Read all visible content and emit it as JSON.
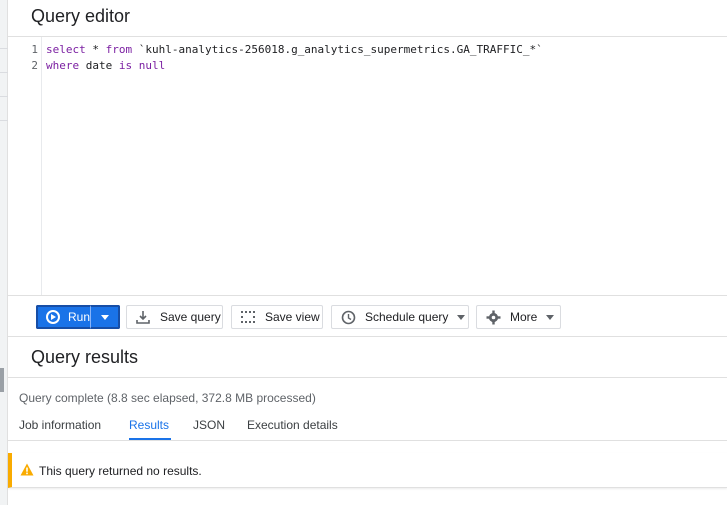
{
  "editor": {
    "title": "Query editor",
    "lines": [
      {
        "number": "1",
        "keyword1": "select",
        "middle": " * ",
        "keyword2": "from",
        "rest": " `kuhl-analytics-256018.g_analytics_supermetrics.GA_TRAFFIC_*`"
      },
      {
        "number": "2",
        "keyword1": "where",
        "middle": " date ",
        "keyword2": "is null",
        "rest": ""
      }
    ]
  },
  "toolbar": {
    "run_label": "Run",
    "save_query_label": "Save query",
    "save_view_label": "Save view",
    "schedule_query_label": "Schedule query",
    "more_label": "More"
  },
  "results": {
    "title": "Query results",
    "status": "Query complete (8.8 sec elapsed, 372.8 MB processed)",
    "tabs": [
      {
        "label": "Job information"
      },
      {
        "label": "Results"
      },
      {
        "label": "JSON"
      },
      {
        "label": "Execution details"
      }
    ],
    "active_tab": "Results",
    "warning_message": "This query returned no results."
  },
  "colors": {
    "accent": "#1a73e8",
    "warning": "#f9ab00",
    "keyword": "#7b1fa2"
  }
}
